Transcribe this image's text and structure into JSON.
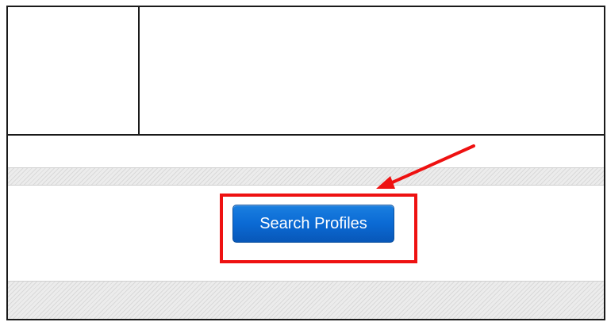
{
  "main": {
    "search_button_label": "Search Profiles"
  },
  "annotation": {
    "color": "#ee1111",
    "arrow_icon": "arrow-icon"
  },
  "colors": {
    "button_blue": "#0b6ad4",
    "frame": "#1a1a1a",
    "hatch": "#ececec"
  }
}
